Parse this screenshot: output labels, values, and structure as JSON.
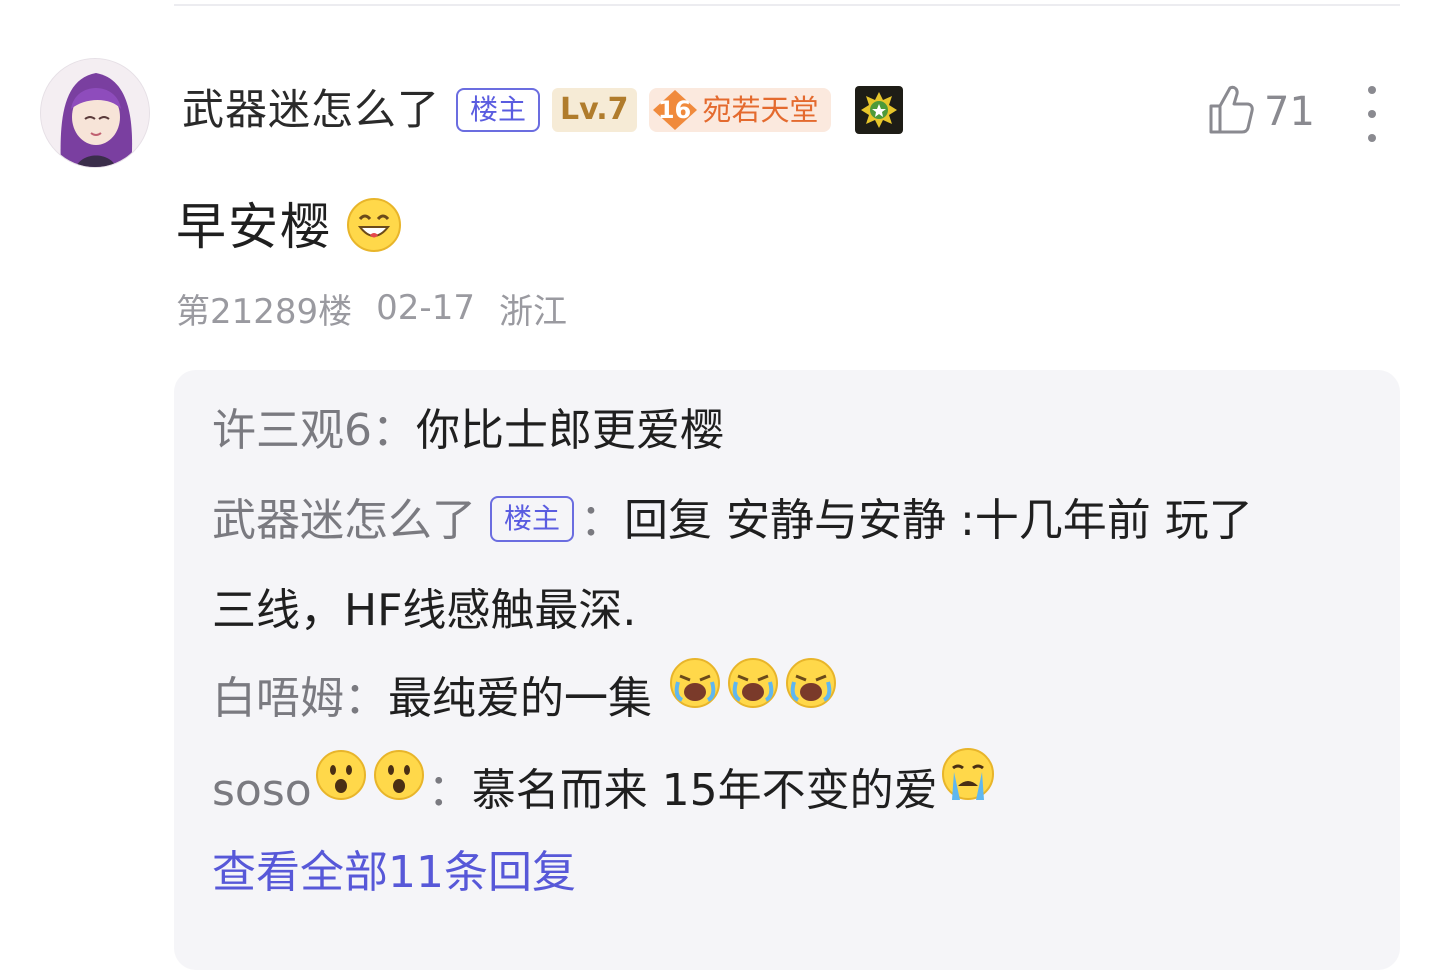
{
  "post": {
    "username": "武器迷怎么了",
    "op_badge": "楼主",
    "level": "Lv.7",
    "title_level": "16",
    "title_name": "宛若天堂",
    "like_count": "71",
    "comment_text": "早安樱",
    "floor": "第21289楼",
    "date": "02-17",
    "location": "浙江"
  },
  "replies": [
    {
      "name": "许三观6",
      "sep": "：",
      "text": "你比士郎更爱樱"
    },
    {
      "name": "武器迷怎么了",
      "badge": "楼主",
      "sep": "：",
      "text_line1": "回复 安静与安静 :十几年前 玩了",
      "text_line2": "三线，HF线感触最深."
    },
    {
      "name": "白唔姆",
      "sep": "：",
      "text": "最纯爱的一集"
    },
    {
      "name": "soso",
      "sep": "：",
      "text": "慕名而来 15年不变的爱"
    }
  ],
  "view_all_label": "查看全部11条回复",
  "colors": {
    "accent": "#5758d8",
    "op_badge": "#6b6de0",
    "level_bg": "#f6ebd6",
    "title_badge_bg": "#fbe9de",
    "reply_bg": "#f5f5f8"
  },
  "icons": [
    "avatar",
    "thumbs-up-icon",
    "more-vertical-icon",
    "medal-icon",
    "grin-emoji",
    "crying-emoji",
    "surprised-emoji",
    "sobbing-emoji"
  ]
}
